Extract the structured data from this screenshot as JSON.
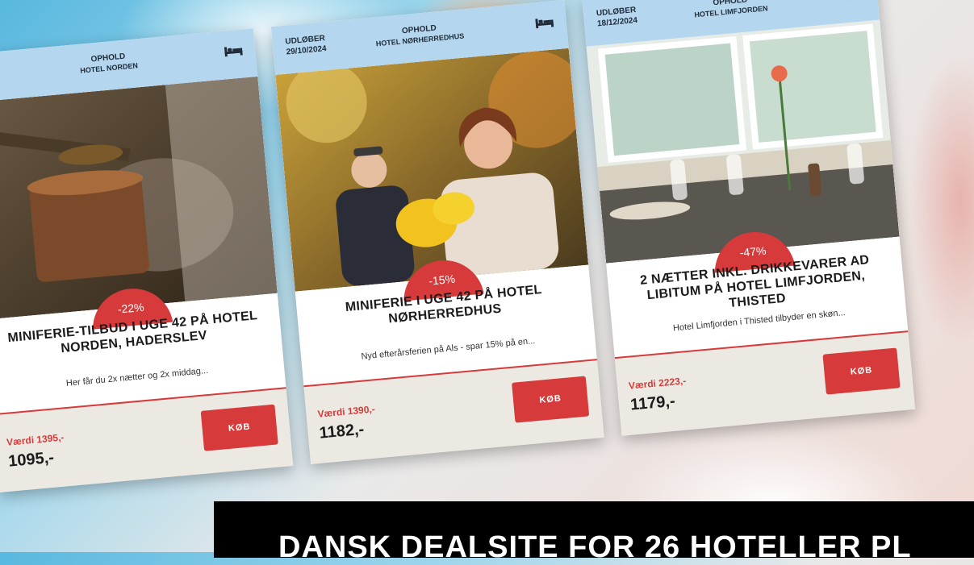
{
  "cards": [
    {
      "expires_label": "",
      "expires_date": "",
      "category": "OPHOLD",
      "hotel": "HOTEL NORDEN",
      "discount": "-22%",
      "title": "MINIFERIE-TILBUD I UGE 42 PÅ HOTEL NORDEN, HADERSLEV",
      "teaser": "Her får du 2x nætter og 2x middag...",
      "value": "Værdi 1395,-",
      "price": "1095,-",
      "buy_label": "KØB"
    },
    {
      "expires_label": "UDLØBER",
      "expires_date": "29/10/2024",
      "category": "OPHOLD",
      "hotel": "HOTEL NØRHERREDHUS",
      "discount": "-15%",
      "title": "MINIFERIE I UGE 42 PÅ HOTEL NØRHERREDHUS",
      "teaser": "Nyd efterårsferien på Als - spar 15% på en...",
      "value": "Værdi 1390,-",
      "price": "1182,-",
      "buy_label": "KØB"
    },
    {
      "expires_label": "UDLØBER",
      "expires_date": "18/12/2024",
      "category": "OPHOLD",
      "hotel": "HOTEL LIMFJORDEN",
      "discount": "-47%",
      "title": "2 NÆTTER INKL. DRIKKEVARER AD LIBITUM PÅ HOTEL LIMFJORDEN, THISTED",
      "teaser": "Hotel Limfjorden i Thisted tilbyder en skøn...",
      "value": "Værdi 2223,-",
      "price": "1179,-",
      "buy_label": "KØB"
    }
  ],
  "banner": {
    "text": "DANSK DEALSITE FOR 26 HOTELLER PL"
  },
  "icons": {
    "card_icon": "bed-icon"
  },
  "colors": {
    "accent": "#d63a3a",
    "header_bg": "#b4d6ee",
    "footer_bg": "#ece9e2"
  }
}
